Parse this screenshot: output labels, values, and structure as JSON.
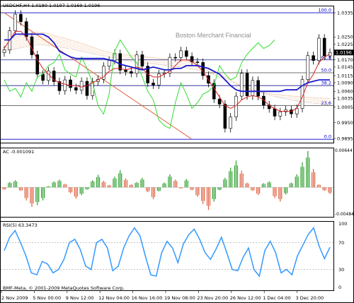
{
  "chart_data": [
    {
      "type": "line",
      "panel": "price",
      "title": "USDCHF,H4  1.0180 1.0197 1.0169 1.0196",
      "watermark": "Boston Merchant Financial",
      "ylim": [
        0.9885,
        1.0355
      ],
      "yticks": [
        "1.0335",
        "1.0250",
        "1.0225",
        "1.0170",
        "1.0145",
        "1.0115",
        "1.0090",
        "1.0060",
        "1.0035",
        "1.0005",
        "0.9950",
        "0.9895"
      ],
      "current_price": "1.0196",
      "fibo": [
        {
          "level": "100.0",
          "price": 1.0335
        },
        {
          "level": "61.8",
          "price": 1.017
        },
        {
          "level": "50.0",
          "price": 1.0125
        },
        {
          "level": "38.2",
          "price": 1.008
        },
        {
          "level": "23.6",
          "price": 1.001
        },
        {
          "level": "0.0",
          "price": 0.9892
        }
      ],
      "series": [
        {
          "key": "close",
          "values": [
            1.0205,
            1.0272,
            1.033,
            1.0304,
            1.0251,
            1.0188,
            1.012,
            1.0098,
            1.0131,
            1.0094,
            1.0062,
            1.01,
            1.0073,
            1.0064,
            1.0095,
            1.0045,
            1.0094,
            1.0102,
            1.0148,
            1.0168,
            1.0192,
            1.0134,
            1.0129,
            1.0123,
            1.0188,
            1.0148,
            1.0089,
            1.0082,
            1.0121,
            1.0124,
            1.0179,
            1.0178,
            1.0202,
            1.0182,
            1.0163,
            1.0161,
            1.0115,
            1.0088,
            1.0033,
            1.0015,
            0.993,
            0.997,
            1.0043,
            1.0123,
            1.0044,
            1.0098,
            1.0043,
            1.0012,
            0.9999,
            0.9973,
            0.9988,
            0.9995,
            0.9981,
            1.0,
            1.0101,
            1.0185,
            1.0168,
            1.0246,
            1.0184,
            1.0196
          ]
        },
        {
          "key": "tenkan",
          "values": [
            1.021,
            1.024,
            1.027,
            1.027,
            1.025,
            1.021,
            1.017,
            1.014,
            1.012,
            1.01,
            1.009,
            1.0085,
            1.008,
            1.008,
            1.0075,
            1.008,
            1.009,
            1.01,
            1.011,
            1.013,
            1.014,
            1.014,
            1.0135,
            1.014,
            1.0145,
            1.014,
            1.012,
            1.011,
            1.011,
            1.012,
            1.013,
            1.015,
            1.017,
            1.017,
            1.0165,
            1.015,
            1.013,
            1.01,
            1.007,
            1.004,
            1.001,
            1.0,
            1.001,
            1.003,
            1.004,
            1.0045,
            1.004,
            1.003,
            1.001,
            1.0,
            0.999,
            0.999,
            0.999,
            1.0,
            1.004,
            1.009,
            1.012,
            1.016,
            1.018,
            1.019
          ]
        },
        {
          "key": "kijun",
          "values": [
            1.024,
            1.024,
            1.026,
            1.026,
            1.026,
            1.026,
            1.026,
            1.026,
            1.025,
            1.023,
            1.02,
            1.019,
            1.018,
            1.0175,
            1.0175,
            1.0175,
            1.0175,
            1.0175,
            1.0175,
            1.017,
            1.0165,
            1.0155,
            1.015,
            1.0145,
            1.014,
            1.0135,
            1.014,
            1.0145,
            1.014,
            1.0135,
            1.0135,
            1.014,
            1.014,
            1.015,
            1.015,
            1.015,
            1.0145,
            1.014,
            1.013,
            1.012,
            1.01,
            1.008,
            1.0065,
            1.006,
            1.006,
            1.006,
            1.006,
            1.006,
            1.006,
            1.006,
            1.006,
            1.0065,
            1.0065,
            1.0065,
            1.008,
            1.009,
            1.0095,
            1.01,
            1.01,
            1.01
          ]
        },
        {
          "key": "chikou",
          "values": [
            1.01,
            1.006,
            1.007,
            1.004,
            1.009,
            1.006,
            1.011,
            1.012,
            1.015,
            1.016,
            1.019,
            1.0135,
            1.012,
            1.011,
            1.018,
            1.014,
            1.009,
            1.001,
            0.998,
            1.005,
            1.02,
            1.024,
            1.021,
            1.018,
            1.016,
            1.011,
            1.006,
            1.003,
            0.996,
            0.994,
            0.993,
            1.002,
            1.009,
            1.005,
            1.0,
            1.002,
            1.005,
            1.006,
            1.008,
            1.015,
            1.012,
            1.01,
            1.011,
            1.016,
            1.019,
            1.021,
            1.023,
            1.021,
            1.022,
            1.024
          ]
        },
        {
          "key": "cloud_a",
          "values": [
            1.024,
            1.0245,
            1.025,
            1.0255,
            1.026,
            1.0265,
            1.0268,
            1.0266,
            1.0262,
            1.0256,
            1.025,
            1.0246,
            1.024,
            1.0234,
            1.0228,
            1.0222,
            1.0215,
            1.0208,
            1.0202,
            1.0198,
            1.0194,
            1.019,
            1.0188,
            1.0186,
            1.0184,
            1.0182,
            1.018,
            1.0178,
            1.0176,
            1.0174,
            1.0172,
            1.017,
            1.0168,
            1.0165,
            1.016,
            1.0154,
            1.0146,
            1.0138,
            1.013,
            1.012,
            1.011,
            1.01,
            1.009,
            1.008,
            1.0072,
            1.0065,
            1.006,
            1.0056,
            1.0052,
            1.005,
            1.0048,
            1.0046,
            1.0044,
            1.0042,
            1.004,
            1.0039,
            1.0038,
            1.0037,
            1.0036,
            1.0035
          ]
        },
        {
          "key": "cloud_b",
          "values": [
            1.02,
            1.0204,
            1.0208,
            1.0212,
            1.0216,
            1.022,
            1.0222,
            1.0222,
            1.022,
            1.0218,
            1.0215,
            1.0212,
            1.0208,
            1.0204,
            1.02,
            1.0196,
            1.0192,
            1.0188,
            1.0184,
            1.018,
            1.0176,
            1.0172,
            1.0168,
            1.0165,
            1.0162,
            1.016,
            1.0158,
            1.0156,
            1.0154,
            1.0152,
            1.015,
            1.0148,
            1.0145,
            1.0142,
            1.0138,
            1.0134,
            1.013,
            1.0124,
            1.0118,
            1.011,
            1.0102,
            1.0094,
            1.0086,
            1.0078,
            1.007,
            1.0064,
            1.0058,
            1.0052,
            1.0047,
            1.0042,
            1.0038,
            1.0034,
            1.003,
            1.0026,
            1.0022,
            1.002,
            1.0018,
            1.0016,
            1.0014,
            1.0012
          ]
        }
      ],
      "trendline": {
        "from": [
          0,
          1.0335
        ],
        "to": [
          34,
          0.9892
        ]
      }
    },
    {
      "type": "bar",
      "panel": "ac",
      "title": "AC -0.001091",
      "ylim": [
        -0.00484,
        0.00644
      ],
      "yticks": [
        "0.00644",
        "-0.00484"
      ],
      "values": [
        -0.0004,
        0.0009,
        0.0012,
        -0.0006,
        -0.0022,
        -0.0033,
        -0.003,
        -0.0022,
        0.0002,
        0.001,
        0.0013,
        0.0006,
        -0.001,
        -0.0019,
        -0.0013,
        -0.0004,
        0.0012,
        0.0021,
        0.0011,
        0.0004,
        0.0018,
        0.0029,
        0.0015,
        0.0005,
        0.0009,
        0.0016,
        -0.0008,
        -0.002,
        -0.0007,
        0.0008,
        0.0022,
        0.0013,
        -0.0002,
        0.0014,
        -0.0005,
        -0.0016,
        -0.0028,
        -0.0038,
        -0.0024,
        -0.0005,
        0.0016,
        0.0033,
        0.0045,
        0.0028,
        0.0008,
        -0.0006,
        -0.0013,
        0.0007,
        0.001,
        -0.0018,
        -0.0024,
        -0.0012,
        0.0008,
        0.0022,
        0.0042,
        0.0061,
        0.0031,
        0.0005,
        -0.0006,
        -0.0011
      ]
    },
    {
      "type": "line",
      "panel": "rsi",
      "title": "RSI(5) 63.3473",
      "ylim": [
        0,
        100
      ],
      "yticks": [
        "100",
        "70",
        "30",
        "0"
      ],
      "values": [
        58,
        78,
        88,
        70,
        50,
        25,
        22,
        42,
        38,
        25,
        30,
        45,
        70,
        75,
        60,
        35,
        30,
        70,
        75,
        62,
        28,
        35,
        62,
        80,
        92,
        80,
        50,
        22,
        20,
        55,
        72,
        62,
        40,
        68,
        82,
        90,
        75,
        55,
        45,
        60,
        78,
        55,
        30,
        28,
        48,
        62,
        30,
        20,
        58,
        72,
        55,
        25,
        30,
        22,
        50,
        66,
        82,
        92,
        65,
        46,
        63
      ]
    }
  ],
  "x_labels": [
    "2 Nov 2009",
    "5 Nov 00:00",
    "9 Nov 12:00",
    "12 Nov 04:00",
    "16 Nov 16:00",
    "19 Nov 08:00",
    "23 Nov 20:00",
    "26 Nov 12:00",
    "1 Dec 04:00",
    "3 Dec 20:00"
  ],
  "copyright": "BMF-Meta, © 2001-2009 MetaQuotes Software Corp.",
  "colors": {
    "up": "#2ea02e",
    "down": "#e06040",
    "rsi": "#3399ff",
    "kijun": "#1a1acc",
    "tenkan": "#dd2222",
    "chikou": "#33dd33",
    "fibo": "#0000cc"
  }
}
